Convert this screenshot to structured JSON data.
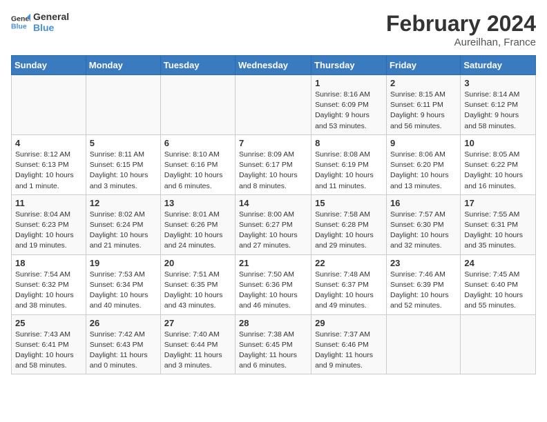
{
  "header": {
    "logo_line1": "General",
    "logo_line2": "Blue",
    "title": "February 2024",
    "subtitle": "Aureilhan, France"
  },
  "columns": [
    "Sunday",
    "Monday",
    "Tuesday",
    "Wednesday",
    "Thursday",
    "Friday",
    "Saturday"
  ],
  "weeks": [
    [
      {
        "day": "",
        "info": ""
      },
      {
        "day": "",
        "info": ""
      },
      {
        "day": "",
        "info": ""
      },
      {
        "day": "",
        "info": ""
      },
      {
        "day": "1",
        "info": "Sunrise: 8:16 AM\nSunset: 6:09 PM\nDaylight: 9 hours\nand 53 minutes."
      },
      {
        "day": "2",
        "info": "Sunrise: 8:15 AM\nSunset: 6:11 PM\nDaylight: 9 hours\nand 56 minutes."
      },
      {
        "day": "3",
        "info": "Sunrise: 8:14 AM\nSunset: 6:12 PM\nDaylight: 9 hours\nand 58 minutes."
      }
    ],
    [
      {
        "day": "4",
        "info": "Sunrise: 8:12 AM\nSunset: 6:13 PM\nDaylight: 10 hours\nand 1 minute."
      },
      {
        "day": "5",
        "info": "Sunrise: 8:11 AM\nSunset: 6:15 PM\nDaylight: 10 hours\nand 3 minutes."
      },
      {
        "day": "6",
        "info": "Sunrise: 8:10 AM\nSunset: 6:16 PM\nDaylight: 10 hours\nand 6 minutes."
      },
      {
        "day": "7",
        "info": "Sunrise: 8:09 AM\nSunset: 6:17 PM\nDaylight: 10 hours\nand 8 minutes."
      },
      {
        "day": "8",
        "info": "Sunrise: 8:08 AM\nSunset: 6:19 PM\nDaylight: 10 hours\nand 11 minutes."
      },
      {
        "day": "9",
        "info": "Sunrise: 8:06 AM\nSunset: 6:20 PM\nDaylight: 10 hours\nand 13 minutes."
      },
      {
        "day": "10",
        "info": "Sunrise: 8:05 AM\nSunset: 6:22 PM\nDaylight: 10 hours\nand 16 minutes."
      }
    ],
    [
      {
        "day": "11",
        "info": "Sunrise: 8:04 AM\nSunset: 6:23 PM\nDaylight: 10 hours\nand 19 minutes."
      },
      {
        "day": "12",
        "info": "Sunrise: 8:02 AM\nSunset: 6:24 PM\nDaylight: 10 hours\nand 21 minutes."
      },
      {
        "day": "13",
        "info": "Sunrise: 8:01 AM\nSunset: 6:26 PM\nDaylight: 10 hours\nand 24 minutes."
      },
      {
        "day": "14",
        "info": "Sunrise: 8:00 AM\nSunset: 6:27 PM\nDaylight: 10 hours\nand 27 minutes."
      },
      {
        "day": "15",
        "info": "Sunrise: 7:58 AM\nSunset: 6:28 PM\nDaylight: 10 hours\nand 29 minutes."
      },
      {
        "day": "16",
        "info": "Sunrise: 7:57 AM\nSunset: 6:30 PM\nDaylight: 10 hours\nand 32 minutes."
      },
      {
        "day": "17",
        "info": "Sunrise: 7:55 AM\nSunset: 6:31 PM\nDaylight: 10 hours\nand 35 minutes."
      }
    ],
    [
      {
        "day": "18",
        "info": "Sunrise: 7:54 AM\nSunset: 6:32 PM\nDaylight: 10 hours\nand 38 minutes."
      },
      {
        "day": "19",
        "info": "Sunrise: 7:53 AM\nSunset: 6:34 PM\nDaylight: 10 hours\nand 40 minutes."
      },
      {
        "day": "20",
        "info": "Sunrise: 7:51 AM\nSunset: 6:35 PM\nDaylight: 10 hours\nand 43 minutes."
      },
      {
        "day": "21",
        "info": "Sunrise: 7:50 AM\nSunset: 6:36 PM\nDaylight: 10 hours\nand 46 minutes."
      },
      {
        "day": "22",
        "info": "Sunrise: 7:48 AM\nSunset: 6:37 PM\nDaylight: 10 hours\nand 49 minutes."
      },
      {
        "day": "23",
        "info": "Sunrise: 7:46 AM\nSunset: 6:39 PM\nDaylight: 10 hours\nand 52 minutes."
      },
      {
        "day": "24",
        "info": "Sunrise: 7:45 AM\nSunset: 6:40 PM\nDaylight: 10 hours\nand 55 minutes."
      }
    ],
    [
      {
        "day": "25",
        "info": "Sunrise: 7:43 AM\nSunset: 6:41 PM\nDaylight: 10 hours\nand 58 minutes."
      },
      {
        "day": "26",
        "info": "Sunrise: 7:42 AM\nSunset: 6:43 PM\nDaylight: 11 hours\nand 0 minutes."
      },
      {
        "day": "27",
        "info": "Sunrise: 7:40 AM\nSunset: 6:44 PM\nDaylight: 11 hours\nand 3 minutes."
      },
      {
        "day": "28",
        "info": "Sunrise: 7:38 AM\nSunset: 6:45 PM\nDaylight: 11 hours\nand 6 minutes."
      },
      {
        "day": "29",
        "info": "Sunrise: 7:37 AM\nSunset: 6:46 PM\nDaylight: 11 hours\nand 9 minutes."
      },
      {
        "day": "",
        "info": ""
      },
      {
        "day": "",
        "info": ""
      }
    ]
  ]
}
